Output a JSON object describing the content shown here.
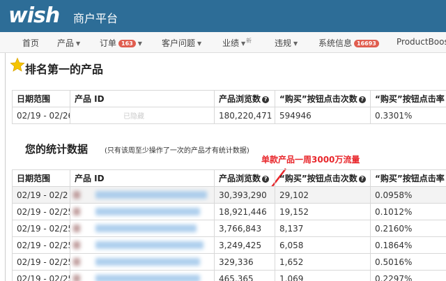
{
  "header": {
    "logo": "wish",
    "portal": "商户平台"
  },
  "nav": {
    "items": [
      {
        "label": "首页"
      },
      {
        "label": "产品"
      },
      {
        "label": "订单",
        "badge": "163"
      },
      {
        "label": "客户问题"
      },
      {
        "label": "业绩",
        "tag": "新"
      },
      {
        "label": "违规"
      },
      {
        "label": "系统信息",
        "badge": "16693"
      },
      {
        "label": "ProductBoos"
      }
    ]
  },
  "section1": {
    "title": "排名第一的产品",
    "headers": [
      "日期范围",
      "产品 ID",
      "产品浏览数",
      "“购买”按钮点击次数",
      "“购买”按钮点击率"
    ],
    "row": {
      "date": "02/19 - 02/26",
      "product": "已隐藏",
      "views": "180,220,471",
      "clicks": "594946",
      "rate": "0.3301%"
    }
  },
  "section2": {
    "title": "您的统计数据",
    "note": "(只有该周至少操作了一次的产品才有统计数据)",
    "headers": [
      "日期范围",
      "产品 ID",
      "产品浏览数",
      "“购买”按钮点击次数",
      "“购买”按钮点击率"
    ],
    "rows": [
      {
        "date": "02/19 - 02/2",
        "views": "30,393,290",
        "clicks": "29,102",
        "rate": "0.0958%"
      },
      {
        "date": "02/19 - 02/25",
        "views": "18,921,446",
        "clicks": "19,152",
        "rate": "0.1012%"
      },
      {
        "date": "02/19 - 02/25",
        "views": "3,766,843",
        "clicks": "8,137",
        "rate": "0.2160%"
      },
      {
        "date": "02/19 - 02/25",
        "views": "3,249,425",
        "clicks": "6,058",
        "rate": "0.1864%"
      },
      {
        "date": "02/19 - 02/25",
        "views": "329,336",
        "clicks": "1,652",
        "rate": "0.5016%"
      },
      {
        "date": "02/19 - 02/25",
        "views": "465,365",
        "clicks": "1,069",
        "rate": "0.2297%"
      }
    ]
  },
  "annotation": "单款产品一周3000万流量",
  "colors": {
    "header": "#2d6d97",
    "badge": "#e05d4f",
    "annotation": "#e8262b"
  }
}
